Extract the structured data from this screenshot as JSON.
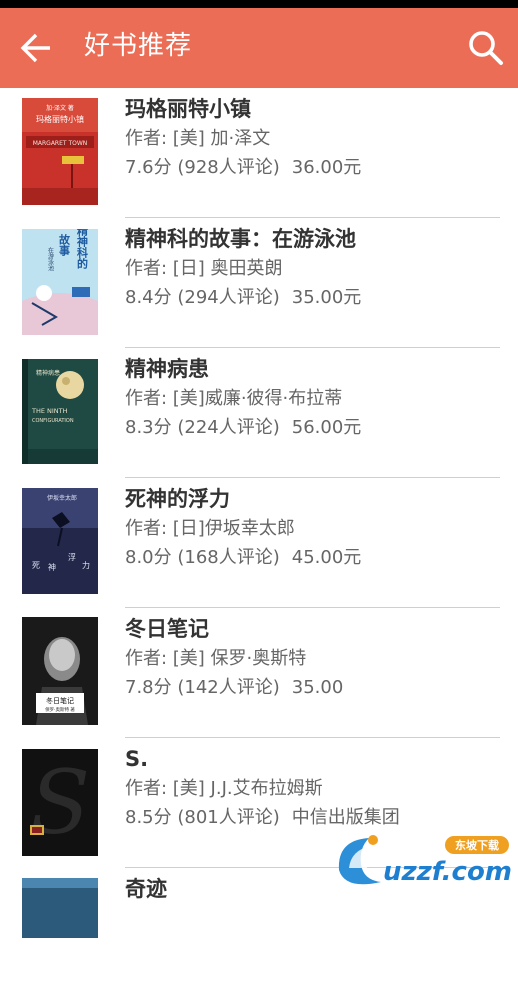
{
  "header": {
    "title": "好书推荐"
  },
  "books": [
    {
      "title": "玛格丽特小镇",
      "author": "作者: [美] 加·泽文",
      "rating": "7.6分 (928人评论)",
      "price": "36.00元"
    },
    {
      "title": "精神科的故事：在游泳池",
      "author": "作者: [日] 奥田英朗",
      "rating": "8.4分 (294人评论)",
      "price": "35.00元"
    },
    {
      "title": "精神病患",
      "author": "作者: [美]威廉·彼得·布拉蒂",
      "rating": "8.3分 (224人评论)",
      "price": "56.00元"
    },
    {
      "title": "死神的浮力",
      "author": "作者: [日]伊坂幸太郎",
      "rating": "8.0分 (168人评论)",
      "price": "45.00元"
    },
    {
      "title": "冬日笔记",
      "author": "作者: [美] 保罗·奥斯特",
      "rating": "7.8分 (142人评论)",
      "price": "35.00"
    },
    {
      "title": "S.",
      "author": "作者: [美] J.J.艾布拉姆斯",
      "rating": "8.5分 (801人评论)",
      "price": "中信出版集团"
    },
    {
      "title": "奇迹",
      "author": "",
      "rating": "",
      "price": ""
    }
  ],
  "covers": {
    "c1": {
      "top_text": "加·泽文 著",
      "title_text": "玛格丽特小镇",
      "band_text": "MARGARET TOWN",
      "color": "#c8322a"
    },
    "c2": {
      "text_a": "精神科的",
      "text_b": "故事",
      "text_c": "在游泳池",
      "color": "#bfe2f0"
    },
    "c3": {
      "top_text": "精神病患",
      "line1": "THE NINTH",
      "line2": "CONFIGURATION",
      "color": "#1f4a44"
    },
    "c4": {
      "top_text": "伊坂幸太郎",
      "text_a": "死",
      "text_b": "神",
      "text_c": "浮",
      "text_d": "力",
      "color": "#23284a"
    },
    "c5": {
      "title_text": "冬日笔记",
      "sub_text": "保罗·奥斯特 著",
      "color": "#1a1a1a"
    },
    "c6": {
      "letter": "S",
      "color": "#111111"
    },
    "c7": {
      "color": "#2b5a7a"
    }
  },
  "watermark": {
    "brand": "uzzf.com",
    "tag": "东坡下载"
  }
}
